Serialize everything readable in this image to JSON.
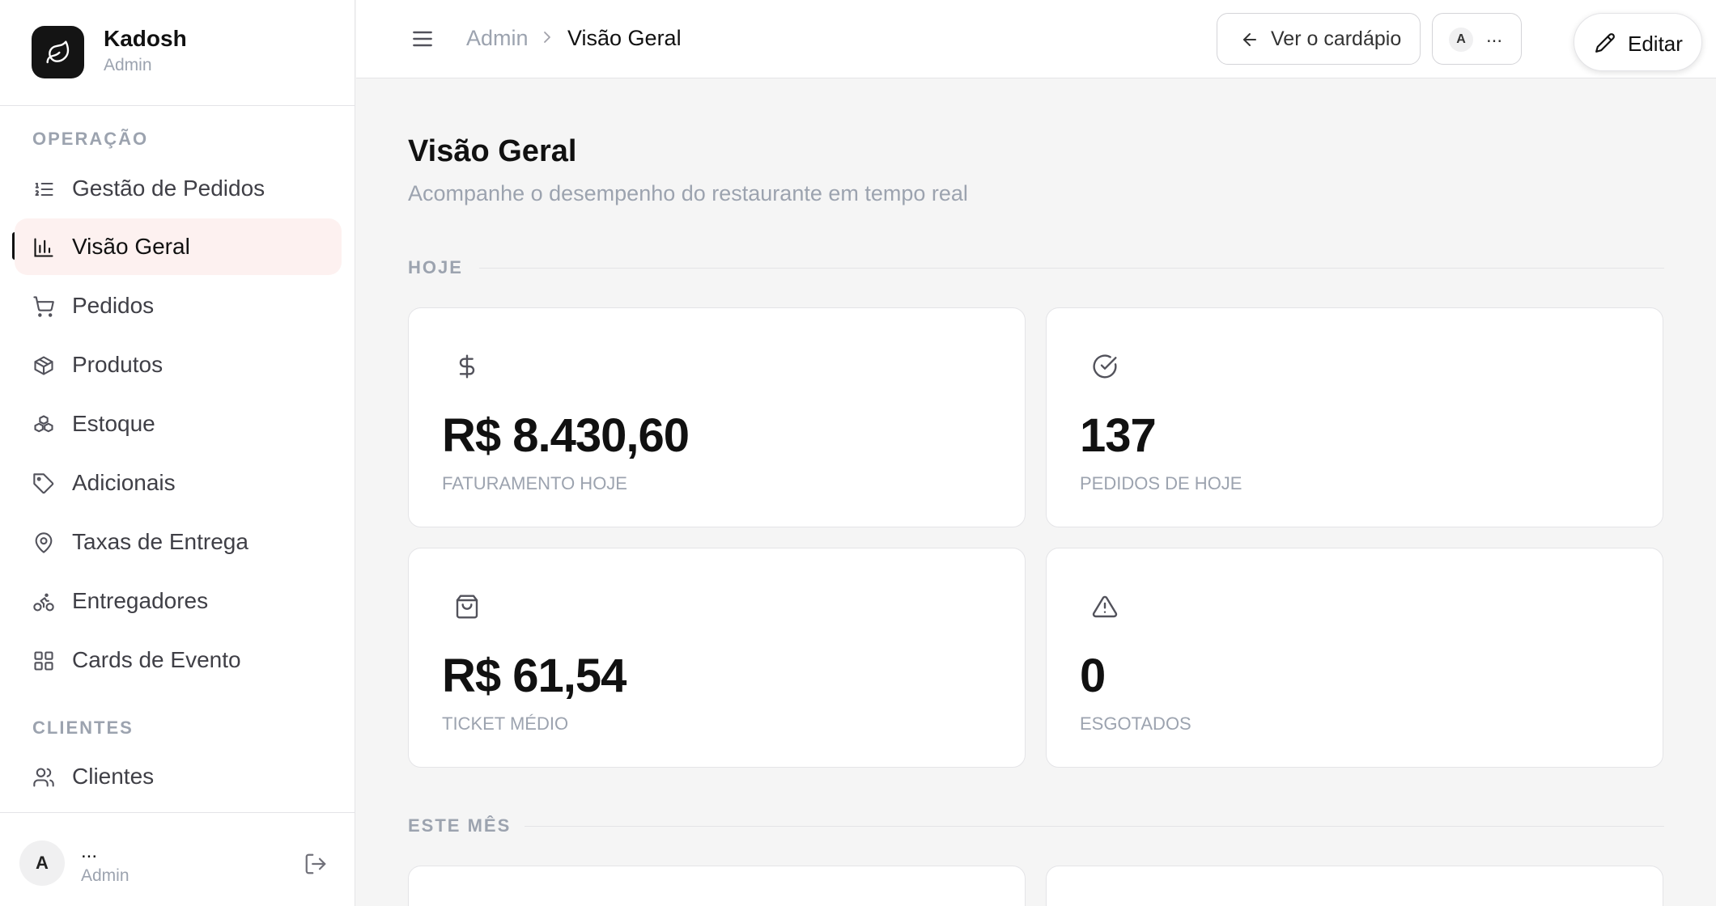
{
  "brand": {
    "name": "Kadosh",
    "subtitle": "Admin"
  },
  "sidebar": {
    "sections": [
      {
        "label": "OPERAÇÃO"
      },
      {
        "label": "CLIENTES"
      }
    ],
    "items": [
      {
        "label": "Gestão de Pedidos",
        "icon": "list-ordered-icon"
      },
      {
        "label": "Visão Geral",
        "icon": "bar-chart-icon",
        "active": true
      },
      {
        "label": "Pedidos",
        "icon": "shopping-cart-icon"
      },
      {
        "label": "Produtos",
        "icon": "package-icon"
      },
      {
        "label": "Estoque",
        "icon": "boxes-icon"
      },
      {
        "label": "Adicionais",
        "icon": "tag-icon"
      },
      {
        "label": "Taxas de Entrega",
        "icon": "map-pin-icon"
      },
      {
        "label": "Entregadores",
        "icon": "bike-icon"
      },
      {
        "label": "Cards de Evento",
        "icon": "grid-icon"
      },
      {
        "label": "Clientes",
        "icon": "users-icon"
      }
    ]
  },
  "user": {
    "avatar": "A",
    "name": "...",
    "role": "Admin"
  },
  "header": {
    "breadcrumb": {
      "root": "Admin",
      "current": "Visão Geral"
    },
    "menu_button": "Ver o cardápio",
    "user_button": {
      "avatar": "A",
      "label": "..."
    },
    "edit_button": "Editar"
  },
  "main": {
    "title": "Visão Geral",
    "subtitle": "Acompanhe o desempenho do restaurante em tempo real",
    "groups": [
      {
        "label": "HOJE"
      },
      {
        "label": "ESTE MÊS"
      }
    ],
    "cards": [
      {
        "value": "R$ 8.430,60",
        "label": "FATURAMENTO HOJE",
        "icon": "dollar-icon"
      },
      {
        "value": "137",
        "label": "PEDIDOS DE HOJE",
        "icon": "check-circle-icon"
      },
      {
        "value": "R$ 61,54",
        "label": "TICKET MÉDIO",
        "icon": "shopping-bag-icon"
      },
      {
        "value": "0",
        "label": "ESGOTADOS",
        "icon": "alert-triangle-icon"
      }
    ]
  },
  "colors": {
    "accent_bg": "#fdf1f0",
    "muted": "#9ca3af",
    "dark": "#141414"
  }
}
